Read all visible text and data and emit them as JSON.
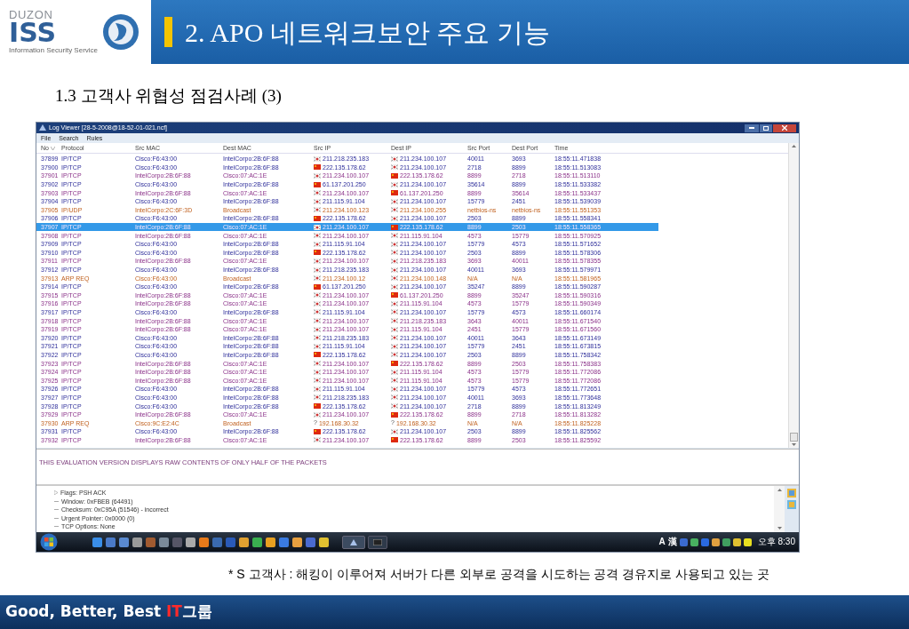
{
  "logo": {
    "brand": "DUZON",
    "mark": "ISS",
    "tagline": "Information Security Service"
  },
  "slide_title": "2. APO 네트워크보안 주요 기능",
  "subtitle": "1.3 고객사 위협성 점검사례 (3)",
  "window": {
    "title": "Log Viewer [28-5-2008@18-52-01-021.ncf]",
    "menu": [
      "File",
      "Search",
      "Rules"
    ]
  },
  "table": {
    "columns": [
      "No",
      "Protocol",
      "Src MAC",
      "Dest MAC",
      "Src IP",
      "Dest IP",
      "Src Port",
      "Dest Port",
      "Time"
    ],
    "rows": [
      {
        "no": "37899",
        "protocol": "IP/TCP",
        "src_mac": "Cisco:F6:43:00",
        "dest_mac": "IntelCorpo:2B:6F:88",
        "src_ip": {
          "kind": "kr",
          "address": "211.218.235.183"
        },
        "dest_ip": {
          "kind": "kr",
          "address": "211.234.100.107"
        },
        "src_port": "40011",
        "dest_port": "3693",
        "time": "18:55:11.471838",
        "kind": "inbound",
        "selected": false
      },
      {
        "no": "37900",
        "protocol": "IP/TCP",
        "src_mac": "Cisco:F6:43:00",
        "dest_mac": "IntelCorpo:2B:6F:88",
        "src_ip": {
          "kind": "cn",
          "address": "222.135.178.62"
        },
        "dest_ip": {
          "kind": "kr",
          "address": "211.234.100.107"
        },
        "src_port": "2718",
        "dest_port": "8899",
        "time": "18:55:11.513083",
        "kind": "inbound",
        "selected": false
      },
      {
        "no": "37901",
        "protocol": "IP/TCP",
        "src_mac": "IntelCorpo:2B:6F:88",
        "dest_mac": "Cisco:07:AC:1E",
        "src_ip": {
          "kind": "kr",
          "address": "211.234.100.107"
        },
        "dest_ip": {
          "kind": "cn",
          "address": "222.135.178.62"
        },
        "src_port": "8899",
        "dest_port": "2718",
        "time": "18:55:11.513110",
        "kind": "outbound",
        "selected": false
      },
      {
        "no": "37902",
        "protocol": "IP/TCP",
        "src_mac": "Cisco:F6:43:00",
        "dest_mac": "IntelCorpo:2B:6F:88",
        "src_ip": {
          "kind": "cn",
          "address": "61.137.201.250"
        },
        "dest_ip": {
          "kind": "kr",
          "address": "211.234.100.107"
        },
        "src_port": "35614",
        "dest_port": "8899",
        "time": "18:55:11.533382",
        "kind": "inbound",
        "selected": false
      },
      {
        "no": "37903",
        "protocol": "IP/TCP",
        "src_mac": "IntelCorpo:2B:6F:88",
        "dest_mac": "Cisco:07:AC:1E",
        "src_ip": {
          "kind": "kr",
          "address": "211.234.100.107"
        },
        "dest_ip": {
          "kind": "cn",
          "address": "61.137.201.250"
        },
        "src_port": "8899",
        "dest_port": "35614",
        "time": "18:55:11.533437",
        "kind": "outbound",
        "selected": false
      },
      {
        "no": "37904",
        "protocol": "IP/TCP",
        "src_mac": "Cisco:F6:43:00",
        "dest_mac": "IntelCorpo:2B:6F:88",
        "src_ip": {
          "kind": "kr",
          "address": "211.115.91.104"
        },
        "dest_ip": {
          "kind": "kr",
          "address": "211.234.100.107"
        },
        "src_port": "15779",
        "dest_port": "2451",
        "time": "18:55:11.539039",
        "kind": "inbound",
        "selected": false
      },
      {
        "no": "37905",
        "protocol": "IP/UDP",
        "src_mac": "IntelCorpo:2C:6F:3D",
        "dest_mac": "Broadcast",
        "src_ip": {
          "kind": "kr",
          "address": "211.234.100.123"
        },
        "dest_ip": {
          "kind": "kr",
          "address": "211.234.100.255"
        },
        "src_port": "netbios-ns",
        "dest_port": "netbios-ns",
        "time": "18:55:11.551353",
        "kind": "broadcast",
        "selected": false
      },
      {
        "no": "37906",
        "protocol": "IP/TCP",
        "src_mac": "Cisco:F6:43:00",
        "dest_mac": "IntelCorpo:2B:6F:88",
        "src_ip": {
          "kind": "cn",
          "address": "222.135.178.62"
        },
        "dest_ip": {
          "kind": "kr",
          "address": "211.234.100.107"
        },
        "src_port": "2503",
        "dest_port": "8899",
        "time": "18:55:11.558341",
        "kind": "inbound",
        "selected": false
      },
      {
        "no": "37907",
        "protocol": "IP/TCP",
        "src_mac": "IntelCorpo:2B:6F:88",
        "dest_mac": "Cisco:07:AC:1E",
        "src_ip": {
          "kind": "kr",
          "address": "211.234.100.107"
        },
        "dest_ip": {
          "kind": "cn",
          "address": "222.135.178.62"
        },
        "src_port": "8899",
        "dest_port": "2503",
        "time": "18:55:11.558365",
        "kind": "outbound",
        "selected": true
      },
      {
        "no": "37908",
        "protocol": "IP/TCP",
        "src_mac": "IntelCorpo:2B:6F:88",
        "dest_mac": "Cisco:07:AC:1E",
        "src_ip": {
          "kind": "kr",
          "address": "211.234.100.107"
        },
        "dest_ip": {
          "kind": "kr",
          "address": "211.115.91.104"
        },
        "src_port": "4573",
        "dest_port": "15779",
        "time": "18:55:11.570925",
        "kind": "outbound",
        "selected": false
      },
      {
        "no": "37909",
        "protocol": "IP/TCP",
        "src_mac": "Cisco:F6:43:00",
        "dest_mac": "IntelCorpo:2B:6F:88",
        "src_ip": {
          "kind": "kr",
          "address": "211.115.91.104"
        },
        "dest_ip": {
          "kind": "kr",
          "address": "211.234.100.107"
        },
        "src_port": "15779",
        "dest_port": "4573",
        "time": "18:55:11.571652",
        "kind": "inbound",
        "selected": false
      },
      {
        "no": "37910",
        "protocol": "IP/TCP",
        "src_mac": "Cisco:F6:43:00",
        "dest_mac": "IntelCorpo:2B:6F:88",
        "src_ip": {
          "kind": "cn",
          "address": "222.135.178.62"
        },
        "dest_ip": {
          "kind": "kr",
          "address": "211.234.100.107"
        },
        "src_port": "2503",
        "dest_port": "8899",
        "time": "18:55:11.578306",
        "kind": "inbound",
        "selected": false
      },
      {
        "no": "37911",
        "protocol": "IP/TCP",
        "src_mac": "IntelCorpo:2B:6F:88",
        "dest_mac": "Cisco:07:AC:1E",
        "src_ip": {
          "kind": "kr",
          "address": "211.234.100.107"
        },
        "dest_ip": {
          "kind": "kr",
          "address": "211.218.235.183"
        },
        "src_port": "3693",
        "dest_port": "40011",
        "time": "18:55:11.578355",
        "kind": "outbound",
        "selected": false
      },
      {
        "no": "37912",
        "protocol": "IP/TCP",
        "src_mac": "Cisco:F6:43:00",
        "dest_mac": "IntelCorpo:2B:6F:88",
        "src_ip": {
          "kind": "kr",
          "address": "211.218.235.183"
        },
        "dest_ip": {
          "kind": "kr",
          "address": "211.234.100.107"
        },
        "src_port": "40011",
        "dest_port": "3693",
        "time": "18:55:11.579971",
        "kind": "inbound",
        "selected": false
      },
      {
        "no": "37913",
        "protocol": "ARP REQ",
        "src_mac": "Cisco:F6:43:00",
        "dest_mac": "Broadcast",
        "src_ip": {
          "kind": "kr",
          "address": "211.234.100.12"
        },
        "dest_ip": {
          "kind": "kr",
          "address": "211.234.100.148"
        },
        "src_port": "N/A",
        "dest_port": "N/A",
        "time": "18:55:11.581965",
        "kind": "broadcast",
        "selected": false
      },
      {
        "no": "37914",
        "protocol": "IP/TCP",
        "src_mac": "Cisco:F6:43:00",
        "dest_mac": "IntelCorpo:2B:6F:88",
        "src_ip": {
          "kind": "cn",
          "address": "61.137.201.250"
        },
        "dest_ip": {
          "kind": "kr",
          "address": "211.234.100.107"
        },
        "src_port": "35247",
        "dest_port": "8899",
        "time": "18:55:11.590287",
        "kind": "inbound",
        "selected": false
      },
      {
        "no": "37915",
        "protocol": "IP/TCP",
        "src_mac": "IntelCorpo:2B:6F:88",
        "dest_mac": "Cisco:07:AC:1E",
        "src_ip": {
          "kind": "kr",
          "address": "211.234.100.107"
        },
        "dest_ip": {
          "kind": "cn",
          "address": "61.137.201.250"
        },
        "src_port": "8899",
        "dest_port": "35247",
        "time": "18:55:11.590316",
        "kind": "outbound",
        "selected": false
      },
      {
        "no": "37916",
        "protocol": "IP/TCP",
        "src_mac": "IntelCorpo:2B:6F:88",
        "dest_mac": "Cisco:07:AC:1E",
        "src_ip": {
          "kind": "kr",
          "address": "211.234.100.107"
        },
        "dest_ip": {
          "kind": "kr",
          "address": "211.115.91.104"
        },
        "src_port": "4573",
        "dest_port": "15779",
        "time": "18:55:11.590349",
        "kind": "outbound",
        "selected": false
      },
      {
        "no": "37917",
        "protocol": "IP/TCP",
        "src_mac": "Cisco:F6:43:00",
        "dest_mac": "IntelCorpo:2B:6F:88",
        "src_ip": {
          "kind": "kr",
          "address": "211.115.91.104"
        },
        "dest_ip": {
          "kind": "kr",
          "address": "211.234.100.107"
        },
        "src_port": "15779",
        "dest_port": "4573",
        "time": "18:55:11.660174",
        "kind": "inbound",
        "selected": false
      },
      {
        "no": "37918",
        "protocol": "IP/TCP",
        "src_mac": "IntelCorpo:2B:6F:88",
        "dest_mac": "Cisco:07:AC:1E",
        "src_ip": {
          "kind": "kr",
          "address": "211.234.100.107"
        },
        "dest_ip": {
          "kind": "kr",
          "address": "211.218.235.183"
        },
        "src_port": "3643",
        "dest_port": "40011",
        "time": "18:55:11.671540",
        "kind": "outbound",
        "selected": false
      },
      {
        "no": "37919",
        "protocol": "IP/TCP",
        "src_mac": "IntelCorpo:2B:6F:88",
        "dest_mac": "Cisco:07:AC:1E",
        "src_ip": {
          "kind": "kr",
          "address": "211.234.100.107"
        },
        "dest_ip": {
          "kind": "kr",
          "address": "211.115.91.104"
        },
        "src_port": "2451",
        "dest_port": "15779",
        "time": "18:55:11.671560",
        "kind": "outbound",
        "selected": false
      },
      {
        "no": "37920",
        "protocol": "IP/TCP",
        "src_mac": "Cisco:F6:43:00",
        "dest_mac": "IntelCorpo:2B:6F:88",
        "src_ip": {
          "kind": "kr",
          "address": "211.218.235.183"
        },
        "dest_ip": {
          "kind": "kr",
          "address": "211.234.100.107"
        },
        "src_port": "40011",
        "dest_port": "3643",
        "time": "18:55:11.673149",
        "kind": "inbound",
        "selected": false
      },
      {
        "no": "37921",
        "protocol": "IP/TCP",
        "src_mac": "Cisco:F6:43:00",
        "dest_mac": "IntelCorpo:2B:6F:88",
        "src_ip": {
          "kind": "kr",
          "address": "211.115.91.104"
        },
        "dest_ip": {
          "kind": "kr",
          "address": "211.234.100.107"
        },
        "src_port": "15779",
        "dest_port": "2451",
        "time": "18:55:11.673815",
        "kind": "inbound",
        "selected": false
      },
      {
        "no": "37922",
        "protocol": "IP/TCP",
        "src_mac": "Cisco:F6:43:00",
        "dest_mac": "IntelCorpo:2B:6F:88",
        "src_ip": {
          "kind": "cn",
          "address": "222.135.178.62"
        },
        "dest_ip": {
          "kind": "kr",
          "address": "211.234.100.107"
        },
        "src_port": "2503",
        "dest_port": "8899",
        "time": "18:55:11.758342",
        "kind": "inbound",
        "selected": false
      },
      {
        "no": "37923",
        "protocol": "IP/TCP",
        "src_mac": "IntelCorpo:2B:6F:88",
        "dest_mac": "Cisco:07:AC:1E",
        "src_ip": {
          "kind": "kr",
          "address": "211.234.100.107"
        },
        "dest_ip": {
          "kind": "cn",
          "address": "222.135.178.62"
        },
        "src_port": "8899",
        "dest_port": "2503",
        "time": "18:55:11.758383",
        "kind": "outbound",
        "selected": false
      },
      {
        "no": "37924",
        "protocol": "IP/TCP",
        "src_mac": "IntelCorpo:2B:6F:88",
        "dest_mac": "Cisco:07:AC:1E",
        "src_ip": {
          "kind": "kr",
          "address": "211.234.100.107"
        },
        "dest_ip": {
          "kind": "kr",
          "address": "211.115.91.104"
        },
        "src_port": "4573",
        "dest_port": "15779",
        "time": "18:55:11.772086",
        "kind": "outbound",
        "selected": false
      },
      {
        "no": "37925",
        "protocol": "IP/TCP",
        "src_mac": "IntelCorpo:2B:6F:88",
        "dest_mac": "Cisco:07:AC:1E",
        "src_ip": {
          "kind": "kr",
          "address": "211.234.100.107"
        },
        "dest_ip": {
          "kind": "kr",
          "address": "211.115.91.104"
        },
        "src_port": "4573",
        "dest_port": "15779",
        "time": "18:55:11.772086",
        "kind": "outbound",
        "selected": false
      },
      {
        "no": "37926",
        "protocol": "IP/TCP",
        "src_mac": "Cisco:F6:43:00",
        "dest_mac": "IntelCorpo:2B:6F:88",
        "src_ip": {
          "kind": "kr",
          "address": "211.115.91.104"
        },
        "dest_ip": {
          "kind": "kr",
          "address": "211.234.100.107"
        },
        "src_port": "15779",
        "dest_port": "4573",
        "time": "18:55:11.772651",
        "kind": "inbound",
        "selected": false
      },
      {
        "no": "37927",
        "protocol": "IP/TCP",
        "src_mac": "Cisco:F6:43:00",
        "dest_mac": "IntelCorpo:2B:6F:88",
        "src_ip": {
          "kind": "kr",
          "address": "211.218.235.183"
        },
        "dest_ip": {
          "kind": "kr",
          "address": "211.234.100.107"
        },
        "src_port": "40011",
        "dest_port": "3693",
        "time": "18:55:11.773648",
        "kind": "inbound",
        "selected": false
      },
      {
        "no": "37928",
        "protocol": "IP/TCP",
        "src_mac": "Cisco:F6:43:00",
        "dest_mac": "IntelCorpo:2B:6F:88",
        "src_ip": {
          "kind": "cn",
          "address": "222.135.178.62"
        },
        "dest_ip": {
          "kind": "kr",
          "address": "211.234.100.107"
        },
        "src_port": "2718",
        "dest_port": "8899",
        "time": "18:55:11.813249",
        "kind": "inbound",
        "selected": false
      },
      {
        "no": "37929",
        "protocol": "IP/TCP",
        "src_mac": "IntelCorpo:2B:6F:88",
        "dest_mac": "Cisco:07:AC:1E",
        "src_ip": {
          "kind": "kr",
          "address": "211.234.100.107"
        },
        "dest_ip": {
          "kind": "cn",
          "address": "222.135.178.62"
        },
        "src_port": "8899",
        "dest_port": "2718",
        "time": "18:55:11.813282",
        "kind": "outbound",
        "selected": false
      },
      {
        "no": "37930",
        "protocol": "ARP REQ",
        "src_mac": "Cisco:9C:E2:4C",
        "dest_mac": "Broadcast",
        "src_ip": {
          "kind": "unknown",
          "symbol": "?",
          "address": "192.168.30.32"
        },
        "dest_ip": {
          "kind": "unknown",
          "symbol": "?",
          "address": "192.168.30.32"
        },
        "src_port": "N/A",
        "dest_port": "N/A",
        "time": "18:55:11.825228",
        "kind": "broadcast",
        "selected": false
      },
      {
        "no": "37931",
        "protocol": "IP/TCP",
        "src_mac": "Cisco:F6:43:00",
        "dest_mac": "IntelCorpo:2B:6F:88",
        "src_ip": {
          "kind": "cn",
          "address": "222.135.178.62"
        },
        "dest_ip": {
          "kind": "kr",
          "address": "211.234.100.107"
        },
        "src_port": "2503",
        "dest_port": "8899",
        "time": "18:55:11.825562",
        "kind": "inbound",
        "selected": false
      },
      {
        "no": "37932",
        "protocol": "IP/TCP",
        "src_mac": "IntelCorpo:2B:6F:88",
        "dest_mac": "Cisco:07:AC:1E",
        "src_ip": {
          "kind": "kr",
          "address": "211.234.100.107"
        },
        "dest_ip": {
          "kind": "cn",
          "address": "222.135.178.62"
        },
        "src_port": "8899",
        "dest_port": "2503",
        "time": "18:55:11.825592",
        "kind": "outbound",
        "selected": false
      }
    ]
  },
  "raw_notice": "THIS EVALUATION VERSION DISPLAYS RAW CONTENTS OF ONLY HALF OF THE PACKETS",
  "details": [
    {
      "label": "Flags: PSH ACK",
      "expanded": false,
      "has_children": true
    },
    {
      "label": "Window: 0xFBEB (64491)",
      "has_children": false
    },
    {
      "label": "Checksum: 0xC95A (51546) - incorrect",
      "has_children": false
    },
    {
      "label": "Urgent Pointer: 0x0000 (0)",
      "has_children": false
    },
    {
      "label": "TCP Options: None",
      "has_children": false
    }
  ],
  "taskbar": {
    "tray_text": [
      "A",
      "漢"
    ],
    "clock": "오후 8:30"
  },
  "caption": "* S 고객사 : 해킹이 이루어져 서버가 다른 외부로 공격을 시도하는 공격 경유지로 사용되고 있는 곳",
  "footer": {
    "text": "Good, Better, Best ",
    "highlight": "IT",
    "suffix": "그룹"
  }
}
